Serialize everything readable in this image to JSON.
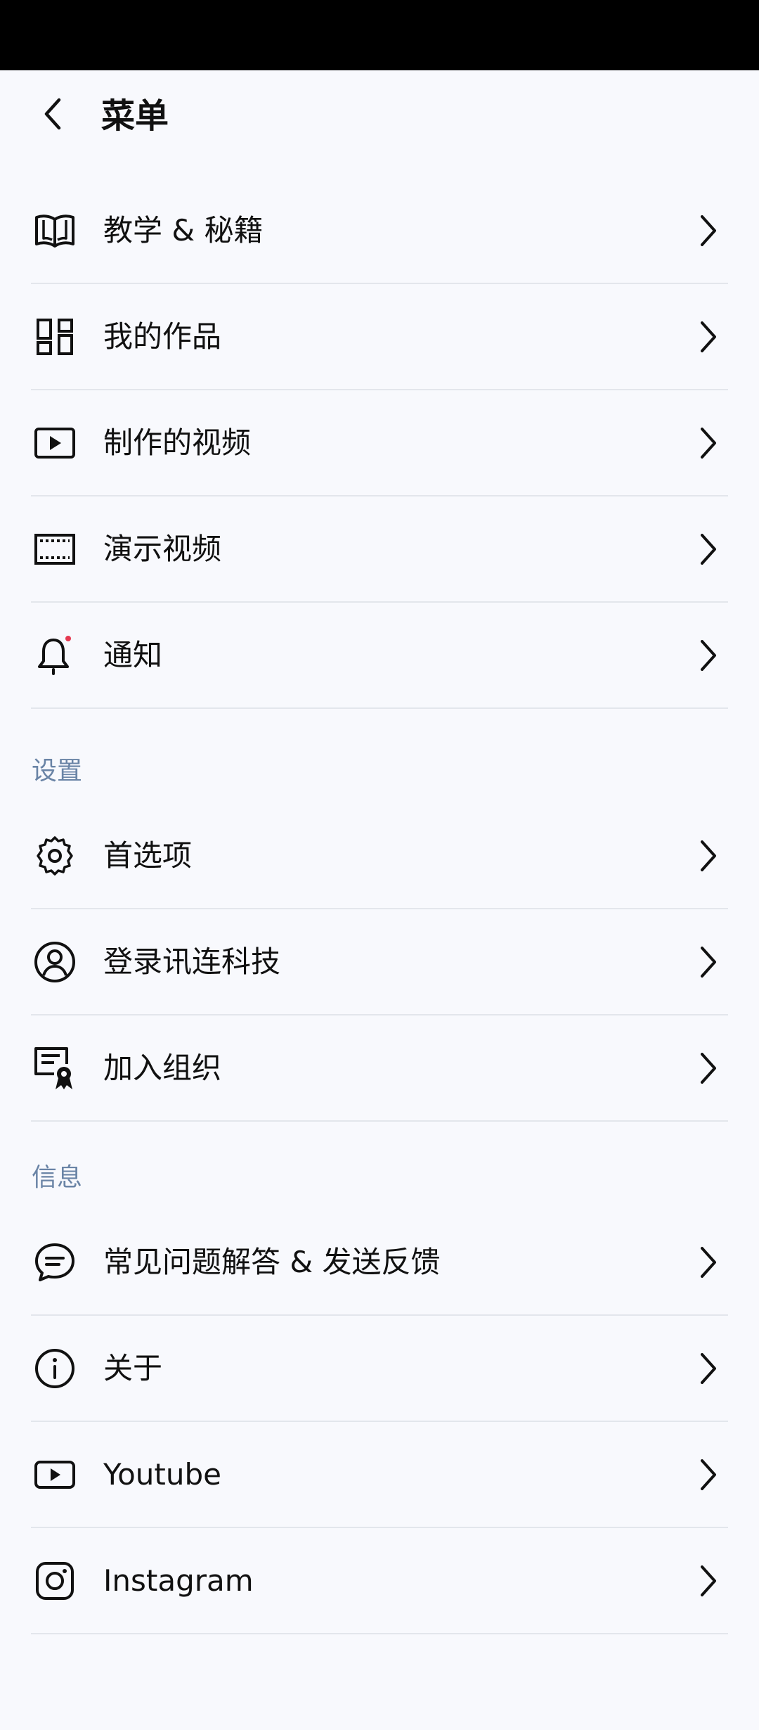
{
  "header": {
    "title": "菜单",
    "back_icon": "chevron-left-icon"
  },
  "main_items": [
    {
      "label": "教学 & 秘籍",
      "icon": "book-icon"
    },
    {
      "label": "我的作品",
      "icon": "grid-icon"
    },
    {
      "label": "制作的视频",
      "icon": "video-play-icon"
    },
    {
      "label": "演示视频",
      "icon": "film-icon"
    },
    {
      "label": "通知",
      "icon": "bell-icon",
      "badge_color": "#E53950"
    }
  ],
  "settings": {
    "title": "设置",
    "items": [
      {
        "label": "首选项",
        "icon": "gear-icon"
      },
      {
        "label": "登录讯连科技",
        "icon": "user-circle-icon"
      },
      {
        "label": "加入组织",
        "icon": "certificate-icon"
      }
    ]
  },
  "info": {
    "title": "信息",
    "items": [
      {
        "label": "常见问题解答 & 发送反馈",
        "icon": "chat-icon"
      },
      {
        "label": "关于",
        "icon": "info-icon"
      },
      {
        "label": "Youtube",
        "icon": "youtube-icon"
      },
      {
        "label": "Instagram",
        "icon": "instagram-icon"
      }
    ]
  },
  "colors": {
    "background": "#F8F9FD",
    "section_header": "#6A84A6",
    "divider": "#E3E6EC",
    "text": "#111111",
    "notification_dot": "#E53950"
  }
}
